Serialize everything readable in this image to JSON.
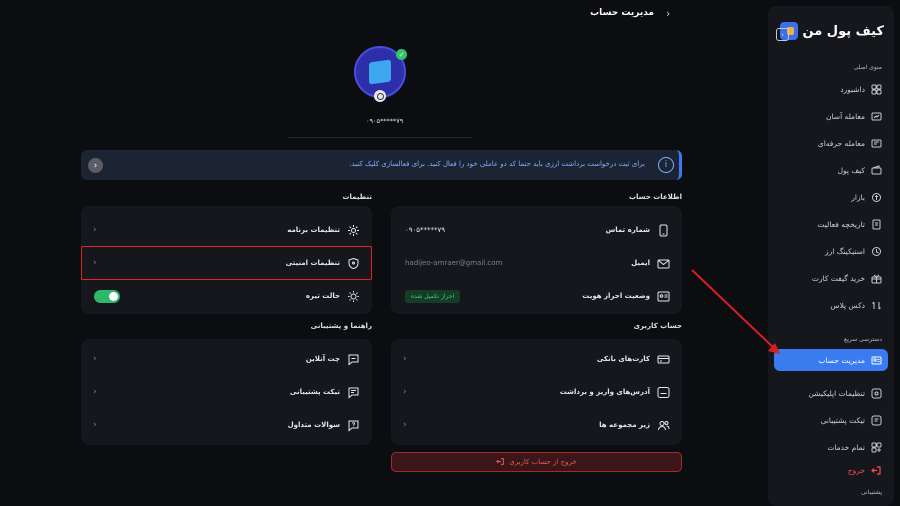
{
  "sidebar": {
    "logo_text": "کیف پول من",
    "main_menu_title": "منوی اصلی",
    "main_items": [
      {
        "label": "داشبورد",
        "icon": "dashboard-icon"
      },
      {
        "label": "معامله آسان",
        "icon": "easy-trade-icon"
      },
      {
        "label": "معامله حرفه‌ای",
        "icon": "pro-trade-icon"
      },
      {
        "label": "کیف پول",
        "icon": "wallet-icon"
      },
      {
        "label": "بازار",
        "icon": "market-icon"
      },
      {
        "label": "تاریخچه فعالیت",
        "icon": "history-icon"
      },
      {
        "label": "استیکینگ ارز",
        "icon": "staking-icon"
      },
      {
        "label": "خرید گیفت کارت",
        "icon": "gift-card-icon"
      },
      {
        "label": "دکس پلاس",
        "icon": "dex-plus-icon"
      }
    ],
    "quick_access_title": "دسترسی سریع",
    "quick_items": [
      {
        "label": "مدیریت حساب",
        "icon": "account-icon",
        "active": true
      },
      {
        "label": "تنظیمات اپلیکیشن",
        "icon": "app-settings-icon"
      },
      {
        "label": "تیکت پشتیبانی",
        "icon": "ticket-icon"
      },
      {
        "label": "تمام خدمات",
        "icon": "services-icon"
      }
    ],
    "logout_label": "خروج",
    "support_title": "پشتیبانی"
  },
  "header": {
    "title": "مدیریت حساب"
  },
  "profile": {
    "phone": "۰۹۰۵*****۷۹"
  },
  "banner": {
    "text": "برای ثبت درخواست برداشت ارزی باید حتما کد دو عاملی خود را فعال کنید. برای فعالسازی کلیک کنید."
  },
  "account_info": {
    "heading": "اطلاعات حساب",
    "rows": [
      {
        "label": "شماره تماس",
        "value": "۰۹۰۵*****۷۹",
        "icon": "phone-icon"
      },
      {
        "label": "ایمیل",
        "value": "hadijeo-amraer@gmail.com",
        "icon": "mail-icon"
      },
      {
        "label": "وضعیت احراز هویت",
        "value": "احراز تکمیل شده",
        "icon": "id-card-icon"
      }
    ]
  },
  "settings": {
    "heading": "تنظیمات",
    "rows": [
      {
        "label": "تنظیمات برنامه",
        "icon": "gear-icon"
      },
      {
        "label": "تنظیمات امنیتی",
        "icon": "shield-icon"
      },
      {
        "label": "حالت تیره",
        "icon": "sun-icon"
      }
    ]
  },
  "user_account": {
    "heading": "حساب کاربری",
    "rows": [
      {
        "label": "کارت‌های بانکی",
        "icon": "bank-card-icon"
      },
      {
        "label": "آدرس‌های واریز و برداشت",
        "icon": "address-icon"
      },
      {
        "label": "زیر مجموعه ها",
        "icon": "referral-icon"
      }
    ],
    "logout_button": "خروج از حساب کاربری"
  },
  "help": {
    "heading": "راهنما و پشتیبانی",
    "rows": [
      {
        "label": "چت آنلاین",
        "icon": "chat-icon"
      },
      {
        "label": "تیکت پشتیبانی",
        "icon": "ticket-icon"
      },
      {
        "label": "سوالات متداول",
        "icon": "faq-icon"
      }
    ]
  },
  "colors": {
    "accent": "#3a7bf0",
    "danger": "#e02424",
    "success": "#2fb86a"
  }
}
